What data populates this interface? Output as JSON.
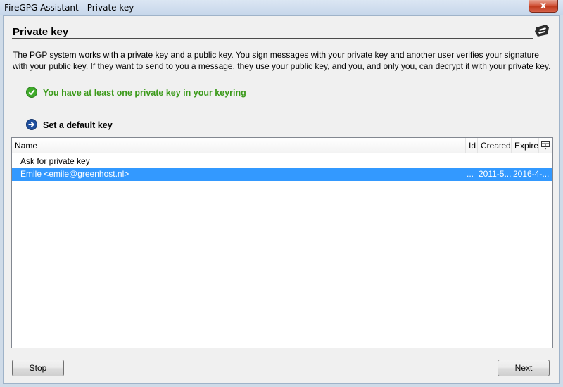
{
  "window": {
    "title": "FireGPG Assistant - Private key",
    "close_label": "x"
  },
  "page": {
    "heading": "Private key",
    "intro": "The PGP system works with a private key and a public key. You sign messages with your private key and another user verifies your signature with your public key. If they want to send to you a message, they use your public key, and you, and only you, can decrypt it with your private key.",
    "status_text": "You have at least one private key in your keyring",
    "step_text": "Set a default key"
  },
  "key_table": {
    "columns": {
      "name": "Name",
      "id": "Id",
      "created": "Created",
      "expire": "Expire"
    },
    "rows": [
      {
        "name": "Ask for private key",
        "id": "",
        "created": "",
        "expire": "",
        "selected": false
      },
      {
        "name": "Emile <emile@greenhost.nl>",
        "id": "...",
        "created": "2011-5...",
        "expire": "2016-4-...",
        "selected": true
      }
    ]
  },
  "buttons": {
    "stop": "Stop",
    "next": "Next"
  },
  "colors": {
    "status_green": "#3b9a1a",
    "selection_blue": "#3399ff"
  }
}
